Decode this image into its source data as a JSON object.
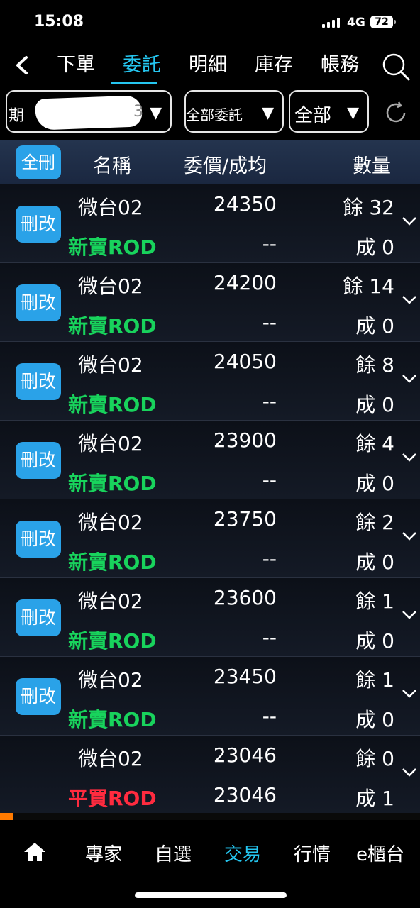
{
  "status": {
    "time": "15:08",
    "network": "4G",
    "battery": "72"
  },
  "topnav": {
    "tabs": [
      {
        "label": "下單"
      },
      {
        "label": "委託"
      },
      {
        "label": "明細"
      },
      {
        "label": "庫存"
      },
      {
        "label": "帳務"
      }
    ],
    "active_index": 1
  },
  "filters": {
    "account_text": "期",
    "account_suffix": "3",
    "order_filter": "全部委託",
    "scope_filter": "全部"
  },
  "table": {
    "delete_all": "全刪",
    "headers": {
      "name": "名稱",
      "price": "委價/成均",
      "qty": "數量"
    },
    "rows": [
      {
        "action": "刪改",
        "name": "微台02",
        "type": "新賣ROD",
        "side": "sell",
        "price": "24350",
        "avg": "--",
        "remaining": "餘 32",
        "filled": "成 0"
      },
      {
        "action": "刪改",
        "name": "微台02",
        "type": "新賣ROD",
        "side": "sell",
        "price": "24200",
        "avg": "--",
        "remaining": "餘 14",
        "filled": "成 0"
      },
      {
        "action": "刪改",
        "name": "微台02",
        "type": "新賣ROD",
        "side": "sell",
        "price": "24050",
        "avg": "--",
        "remaining": "餘 8",
        "filled": "成 0"
      },
      {
        "action": "刪改",
        "name": "微台02",
        "type": "新賣ROD",
        "side": "sell",
        "price": "23900",
        "avg": "--",
        "remaining": "餘 4",
        "filled": "成 0"
      },
      {
        "action": "刪改",
        "name": "微台02",
        "type": "新賣ROD",
        "side": "sell",
        "price": "23750",
        "avg": "--",
        "remaining": "餘 2",
        "filled": "成 0"
      },
      {
        "action": "刪改",
        "name": "微台02",
        "type": "新賣ROD",
        "side": "sell",
        "price": "23600",
        "avg": "--",
        "remaining": "餘 1",
        "filled": "成 0"
      },
      {
        "action": "刪改",
        "name": "微台02",
        "type": "新賣ROD",
        "side": "sell",
        "price": "23450",
        "avg": "--",
        "remaining": "餘 1",
        "filled": "成 0"
      },
      {
        "action": "",
        "name": "微台02",
        "type": "平買ROD",
        "side": "buy",
        "price": "23046",
        "avg": "23046",
        "remaining": "餘 0",
        "filled": "成 1"
      }
    ]
  },
  "bottomnav": {
    "items": [
      {
        "label": "專家"
      },
      {
        "label": "自選"
      },
      {
        "label": "交易"
      },
      {
        "label": "行情"
      },
      {
        "label": "e櫃台"
      }
    ],
    "active_index": 2
  },
  "colors": {
    "accent": "#25c6f0",
    "button": "#2aa2e8",
    "sell": "#18d35c",
    "buy": "#ff2b3f",
    "progress": "#ff7a00"
  }
}
